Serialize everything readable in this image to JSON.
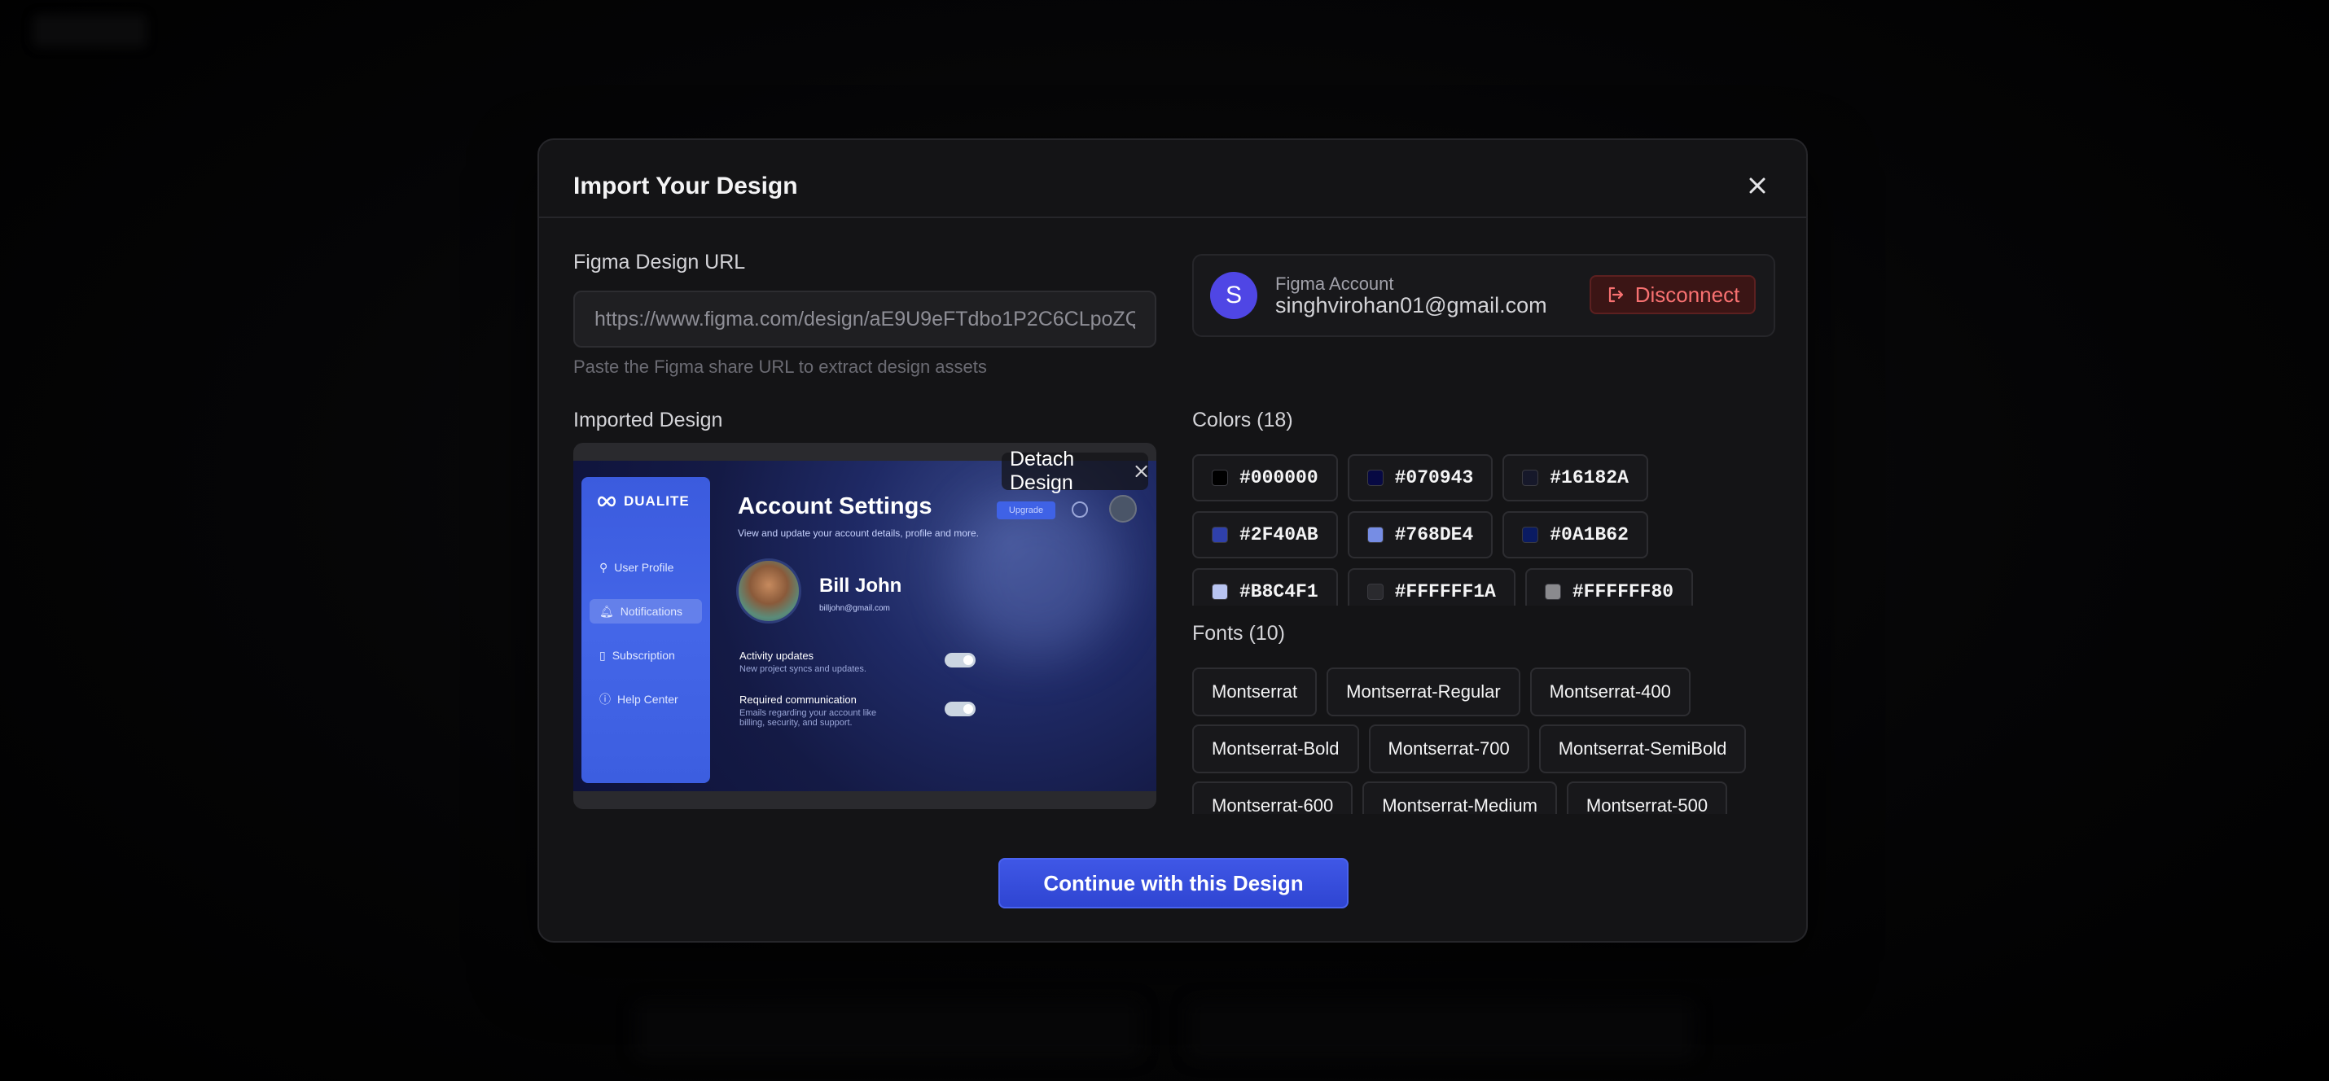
{
  "modal": {
    "title": "Import Your Design",
    "figma_url_label": "Figma Design URL",
    "figma_url_value": "https://www.figma.com/design/aE9U9eFTdbo1P2C6CLpoZQ",
    "figma_url_hint": "Paste the Figma share URL to extract design assets",
    "imported_label": "Imported Design",
    "detach_label": "Detach Design",
    "continue_label": "Continue with this Design"
  },
  "account": {
    "avatar_initial": "S",
    "label": "Figma Account",
    "email": "singhvirohan01@gmail.com",
    "disconnect_label": "Disconnect"
  },
  "preview": {
    "brand": "DUALITE",
    "nav": [
      "User Profile",
      "Notifications",
      "Subscription",
      "Help Center"
    ],
    "title": "Account Settings",
    "subtitle": "View and update your account details, profile and more.",
    "upgrade": "Upgrade",
    "user_name": "Bill John",
    "user_email": "billjohn@gmail.com",
    "rows": [
      {
        "title": "Activity updates",
        "sub": "New project syncs and updates."
      },
      {
        "title": "Required communication",
        "sub": "Emails regarding your account like billing, security, and support."
      }
    ]
  },
  "colors": {
    "label": "Colors (18)",
    "items": [
      {
        "hex": "#000000",
        "swatch": "#000000"
      },
      {
        "hex": "#070943",
        "swatch": "#070943"
      },
      {
        "hex": "#16182A",
        "swatch": "#16182A"
      },
      {
        "hex": "#2F40AB",
        "swatch": "#2F40AB"
      },
      {
        "hex": "#768DE4",
        "swatch": "#768DE4"
      },
      {
        "hex": "#0A1B62",
        "swatch": "#0A1B62"
      },
      {
        "hex": "#B8C4F1",
        "swatch": "#B8C4F1"
      },
      {
        "hex": "#FFFFFF1A",
        "swatch": "#2a2a2e"
      },
      {
        "hex": "#FFFFFF80",
        "swatch": "#8a8a8e"
      }
    ]
  },
  "fonts": {
    "label": "Fonts (10)",
    "items": [
      "Montserrat",
      "Montserrat-Regular",
      "Montserrat-400",
      "Montserrat-Bold",
      "Montserrat-700",
      "Montserrat-SemiBold",
      "Montserrat-600",
      "Montserrat-Medium",
      "Montserrat-500"
    ]
  }
}
